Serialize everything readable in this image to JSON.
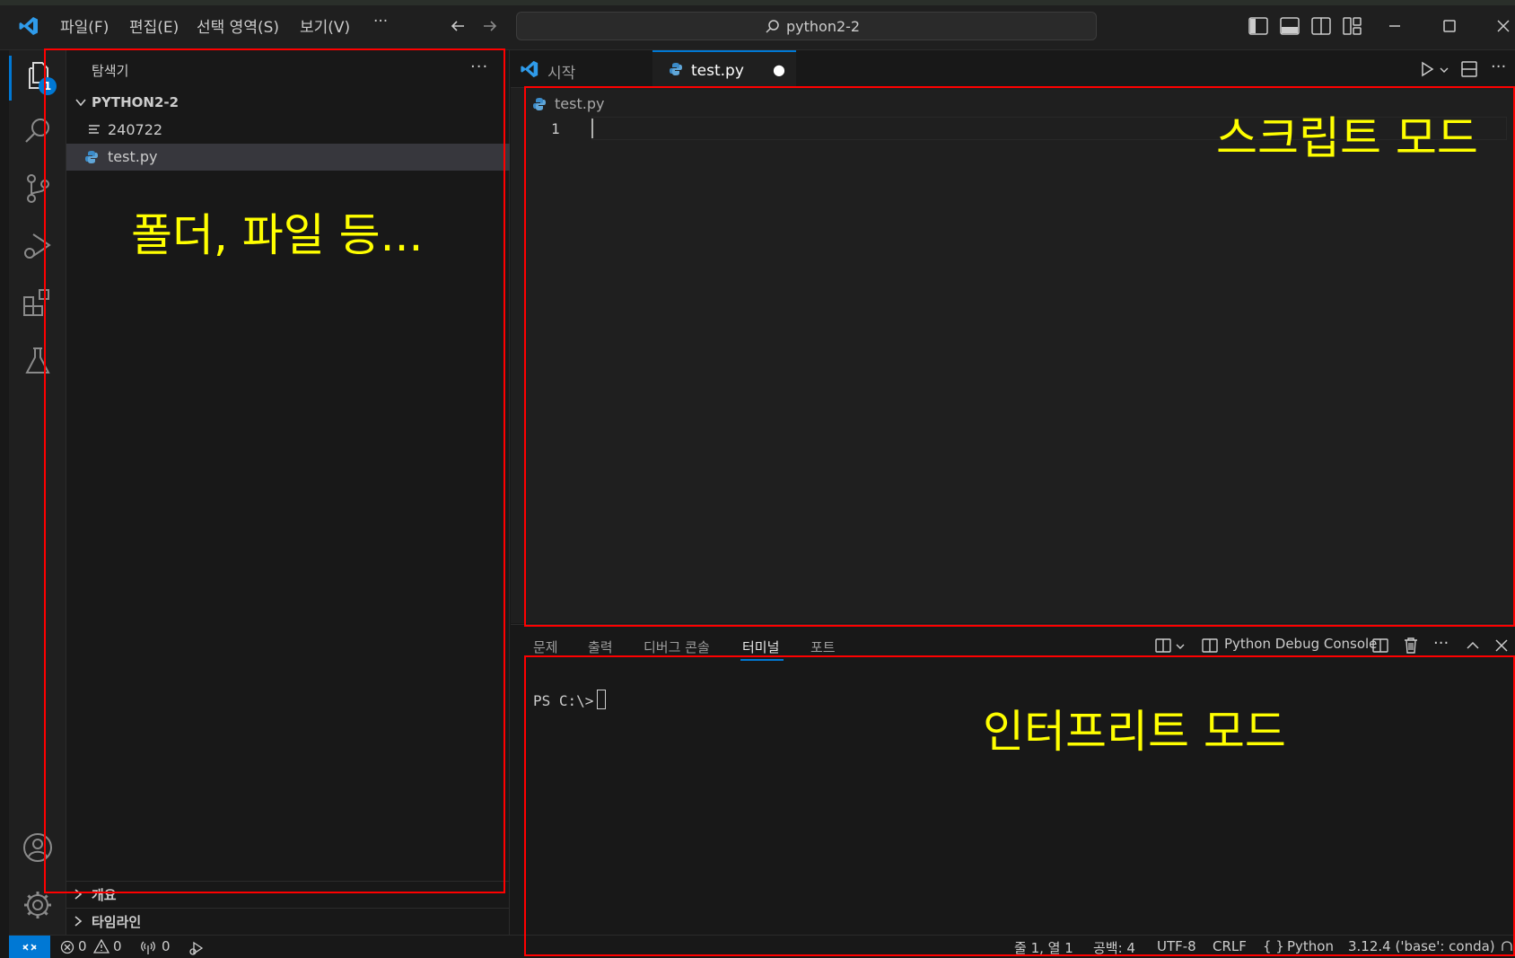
{
  "titlebar": {
    "menu": [
      "파일(F)",
      "편집(E)",
      "선택 영역(S)",
      "보기(V)",
      "···"
    ],
    "command_center": "python2-2"
  },
  "activitybar": {
    "explorer_badge": "1"
  },
  "sidebar": {
    "title": "탐색기",
    "more": "···",
    "folder": "PYTHON2-2",
    "items": [
      {
        "label": "240722"
      },
      {
        "label": "test.py"
      }
    ],
    "sections": [
      "개요",
      "타임라인"
    ]
  },
  "tabs": [
    {
      "label": "시작"
    },
    {
      "label": "test.py",
      "modified_dot": "●"
    }
  ],
  "editor": {
    "breadcrumb": "test.py",
    "line_number": "1"
  },
  "panel": {
    "tabs": [
      "문제",
      "출력",
      "디버그 콘솔",
      "터미널",
      "포트"
    ],
    "terminal_name": "Python Debug Console",
    "terminal_prompt": "PS C:\\>"
  },
  "statusbar": {
    "errors": "0",
    "warnings": "0",
    "ports": "0",
    "position": "줄 1, 열 1",
    "spaces": "공백: 4",
    "encoding": "UTF-8",
    "eol": "CRLF",
    "language": "Python",
    "interpreter": "3.12.4 ('base': conda)"
  },
  "annotations": {
    "sidebar": "폴더, 파일 등...",
    "editor": "스크립트 모드",
    "terminal": "인터프리트 모드"
  },
  "colors": {
    "accent": "#0078d4",
    "annotation_box": "#ff0000",
    "annotation_text": "#ffff00"
  }
}
